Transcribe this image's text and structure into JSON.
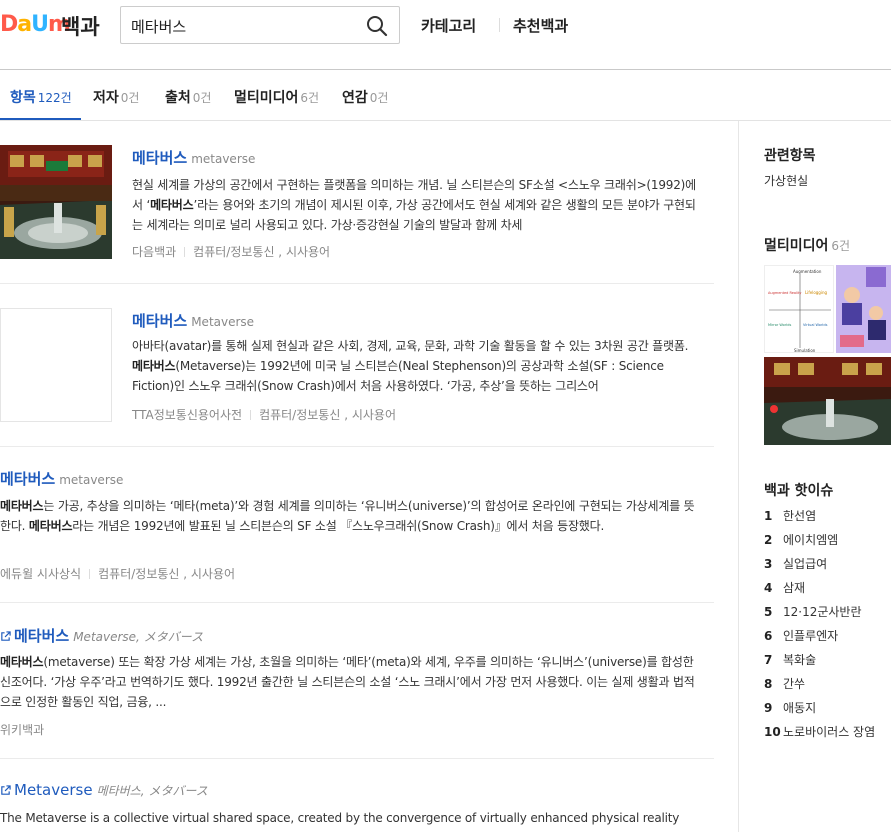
{
  "header": {
    "logo_letters": [
      "D",
      "a",
      "U",
      "m"
    ],
    "logo_colors": [
      "#ff5a4a",
      "#ffb300",
      "#2fb3ff",
      "#ff5a4a"
    ],
    "service_name": "백과",
    "search_value": "메타버스",
    "category_label": "카테고리",
    "recommend_label": "추천백과"
  },
  "tabs": [
    {
      "label": "항목",
      "count": "122건",
      "active": true
    },
    {
      "label": "저자",
      "count": "0건"
    },
    {
      "label": "출처",
      "count": "0건"
    },
    {
      "label": "멀티미디어",
      "count": "6건"
    },
    {
      "label": "연감",
      "count": "0건"
    }
  ],
  "results": [
    {
      "title": "메타버스",
      "subtitle": "metaverse",
      "desc_html": "현실 세계를 가상의 공간에서 구현하는 플랫폼을 의미하는 개념. 닐 스티븐슨의 SF소설 &lt;스노우 크래쉬&gt;(1992)에서 ‘<b>메타버스</b>’라는 용어와 초기의 개념이 제시된 이후, 가상 공간에서도 현실 세계와 같은 생활의 모든 분야가 구현되는 세계라는 의미로 널리 사용되고 있다. 가상·증강현실 기술의 발달과 함께 차세",
      "source": "다음백과",
      "category": "컴퓨터/정보통신 , 시사용어"
    },
    {
      "title": "메타버스",
      "subtitle": "Metaverse",
      "desc_html": "아바타(avatar)를 통해 실제 현실과 같은 사회, 경제, 교육, 문화, 과학 기술 활동을 할 수 있는 3차원 공간 플랫폼. <b>메타버스</b>(Metaverse)는 1992년에 미국 닐 스티븐슨(Neal Stephenson)의 공상과학 소설(SF : Science Fiction)인 스노우 크래쉬(Snow Crash)에서 처음 사용하였다. ‘가공, 추상’을 뜻하는 그리스어",
      "source": "TTA정보통신용어사전",
      "category": "컴퓨터/정보통신 , 시사용어"
    },
    {
      "title": "메타버스",
      "subtitle": "metaverse",
      "desc_html": "<b>메타버스</b>는 가공, 추상을 의미하는 ‘메타(meta)’와 경험 세계를 의미하는 ‘유니버스(universe)’의 합성어로 온라인에 구현되는 가상세계를 뜻한다. <b>메타버스</b>라는 개념은 1992년에 발표된 닐 스티븐슨의 SF 소설 『스노우크래쉬(Snow Crash)』에서 처음 등장했다.",
      "source": "에듀윌 시사상식",
      "category": "컴퓨터/정보통신 , 시사용어"
    },
    {
      "title": "메타버스",
      "subtitle": "Metaverse, メタバース",
      "desc_html": "<b>메타버스</b>(metaverse) 또는 확장 가상 세계는 가상, 초월을 의미하는 ‘메타’(meta)와 세계, 우주를 의미하는 ‘유니버스’(universe)를 합성한 신조어다. ‘가상 우주’라고 번역하기도 했다. 1992년 출간한 닐 스티븐슨의 소설 ‘스노 크래시’에서 가장 먼저 사용했다. 이는 실제 생활과 법적으로 인정한 활동인 직업, 금융, ...",
      "source": "위키백과"
    },
    {
      "title": "Metaverse",
      "subtitle": "메타버스, メタバース",
      "desc_html": "The Metaverse is a collective virtual shared space, created by the convergence of virtually enhanced physical reality and"
    }
  ],
  "sidebar": {
    "related_heading": "관련항목",
    "related_item": "가상현실",
    "multimedia_heading": "멀티미디어",
    "multimedia_count": "6건",
    "diagram_labels": {
      "top": "Augmentation",
      "left_top": "Augmented Reality",
      "right_top": "Lifelogging",
      "left_bottom": "Mirror Worlds",
      "right_bottom": "Virtual Worlds",
      "bottom": "Simulation"
    },
    "hot_heading": "백과 핫이슈",
    "hot_issues": [
      {
        "rank": "1",
        "label": "한선염"
      },
      {
        "rank": "2",
        "label": "에이치엠엠"
      },
      {
        "rank": "3",
        "label": "실업급여"
      },
      {
        "rank": "4",
        "label": "삼재"
      },
      {
        "rank": "5",
        "label": "12·12군사반란"
      },
      {
        "rank": "6",
        "label": "인플루엔자"
      },
      {
        "rank": "7",
        "label": "복화술"
      },
      {
        "rank": "8",
        "label": "간쑤"
      },
      {
        "rank": "9",
        "label": "애동지"
      },
      {
        "rank": "10",
        "label": "노로바이러스 장염"
      }
    ]
  },
  "colors": {
    "link": "#1f5bbd",
    "muted": "#888888"
  }
}
